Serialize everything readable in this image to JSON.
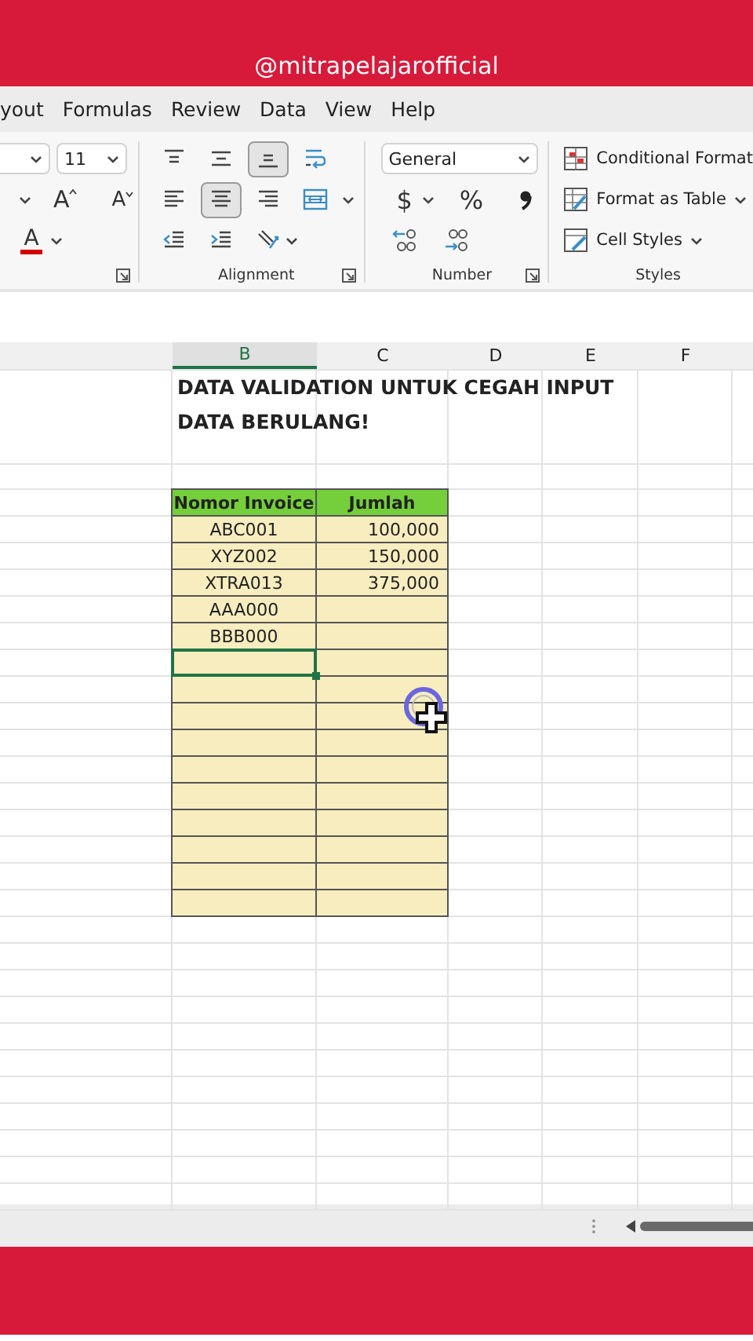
{
  "banner": {
    "handle": "@mitrapelajarofficial"
  },
  "menu_tabs": [
    "yout",
    "Formulas",
    "Review",
    "Data",
    "View",
    "Help"
  ],
  "ribbon": {
    "font": {
      "size": "11",
      "grow": "A",
      "shrink": "A",
      "font_color": "A",
      "color": "#d00000"
    },
    "alignment": {
      "label": "Alignment",
      "vertical": [
        {
          "kind": "top",
          "selected": false
        },
        {
          "kind": "middle",
          "selected": false
        },
        {
          "kind": "bottom",
          "selected": true
        }
      ],
      "horizontal": [
        {
          "kind": "left",
          "selected": false
        },
        {
          "kind": "center",
          "selected": true
        },
        {
          "kind": "right",
          "selected": false
        }
      ]
    },
    "number": {
      "format": "General",
      "currency": "$",
      "percent": "%",
      "label": "Number"
    },
    "styles": {
      "label": "Styles",
      "items": [
        {
          "kind": "conditional",
          "label": "Conditional Format",
          "dropdown": false
        },
        {
          "kind": "table",
          "label": "Format as Table",
          "dropdown": true
        },
        {
          "kind": "cell",
          "label": "Cell Styles",
          "dropdown": true
        }
      ]
    }
  },
  "sheet": {
    "columns": [
      {
        "label": "B",
        "selected": true
      },
      {
        "label": "C",
        "selected": false
      },
      {
        "label": "D",
        "selected": false
      },
      {
        "label": "E",
        "selected": false
      },
      {
        "label": "F",
        "selected": false
      }
    ],
    "title_lines": [
      "DATA VALIDATION UNTUK CEGAH INPUT",
      "DATA BERULANG!"
    ],
    "table": {
      "columns": [
        "Nomor Invoice",
        "Jumlah"
      ],
      "rows": [
        {
          "invoice": "ABC001",
          "amount": "100,000",
          "selected": false
        },
        {
          "invoice": "XYZ002",
          "amount": "150,000",
          "selected": false
        },
        {
          "invoice": "XTRA013",
          "amount": "375,000",
          "selected": false
        },
        {
          "invoice": "AAA000",
          "selected": false
        },
        {
          "invoice": "BBB000",
          "selected": false
        },
        {
          "selected": true
        },
        {
          "selected": false
        },
        {
          "selected": false
        },
        {
          "selected": false
        },
        {
          "selected": false
        },
        {
          "selected": false
        },
        {
          "selected": false
        },
        {
          "selected": false
        },
        {
          "selected": false
        },
        {
          "selected": false
        }
      ]
    }
  }
}
